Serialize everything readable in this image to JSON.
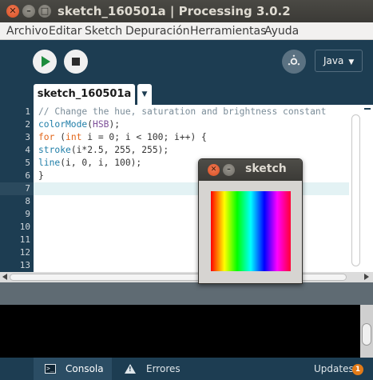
{
  "window": {
    "title": "sketch_160501a | Processing 3.0.2",
    "close_glyph": "✕",
    "min_glyph": "–",
    "max_glyph": "□"
  },
  "menu": {
    "items": [
      {
        "label": "Archivo"
      },
      {
        "label": "Editar"
      },
      {
        "label": "Sketch"
      },
      {
        "label": "Depuración"
      },
      {
        "label": "Herramientas"
      },
      {
        "label": "Ayuda"
      }
    ]
  },
  "toolbar": {
    "run_icon": "play-icon",
    "stop_icon": "stop-icon",
    "debug_glyph": "ꗝ",
    "mode": "Java",
    "mode_caret": "▼"
  },
  "tabs": {
    "active": "sketch_160501a",
    "menu_glyph": "▼"
  },
  "editor": {
    "line_numbers": [
      "1",
      "2",
      "3",
      "4",
      "5",
      "6",
      "7",
      "8",
      "9",
      "10",
      "11",
      "12",
      "13"
    ],
    "current_line": 7,
    "lines": [
      "// Change the hue, saturation and brightness constant",
      "colorMode(HSB);",
      "for (int i = 0; i < 100; i++) {",
      "stroke(i*2.5, 255, 255);",
      "line(i, 0, i, 100);",
      "}"
    ]
  },
  "sketch_window": {
    "title": "sketch",
    "close_glyph": "✕",
    "min_glyph": "–"
  },
  "footer": {
    "console_label": "Consola",
    "console_glyph": ">_",
    "errors_label": "Errores",
    "errors_glyph": "!",
    "updates_label": "Updates",
    "updates_count": "1"
  },
  "colors": {
    "accent": "#1d3d52",
    "keyword": "#e2661a",
    "function": "#1f7ea8",
    "constant": "#7d4f99",
    "comment": "#7a8c98",
    "updates_badge": "#e27a17"
  }
}
